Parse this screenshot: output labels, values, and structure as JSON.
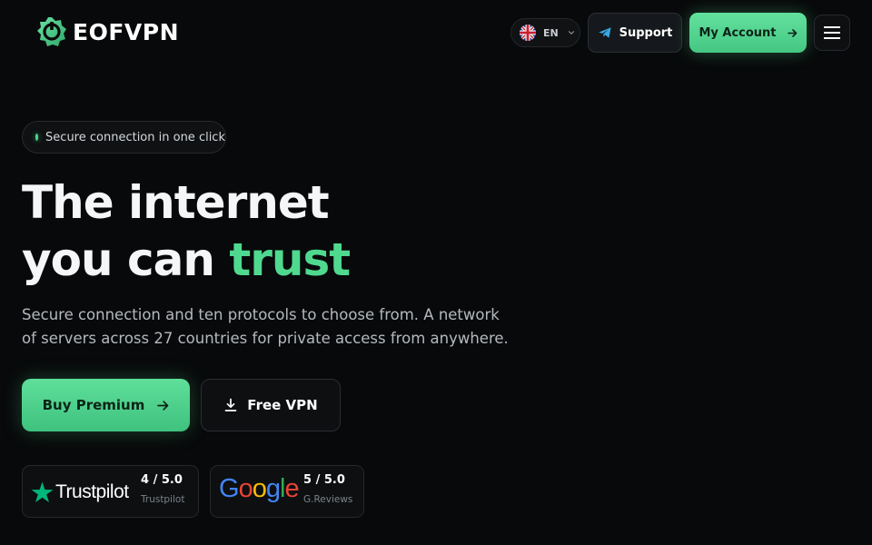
{
  "header": {
    "brand_name": "EOFVPN",
    "language": {
      "code": "EN",
      "flag_icon": "uk-flag-icon"
    },
    "support_label": "Support",
    "account_label": "My Account",
    "menu_icon": "hamburger-menu-icon"
  },
  "hero": {
    "badge_text": "Secure connection in one click",
    "title_line1": "The internet",
    "title_line2_plain": "you can ",
    "title_line2_accent": "trust",
    "description": "Secure connection and ten protocols to choose from. A network of servers across 27 countries for private access from anywhere.",
    "buy_label": "Buy Premium",
    "free_label": "Free VPN"
  },
  "reviews": [
    {
      "brand": "Trustpilot",
      "score": "4 / 5.0",
      "source": "Trustpilot"
    },
    {
      "brand": "Google",
      "score": "5 / 5.0",
      "source": "G.Reviews"
    }
  ],
  "colors": {
    "background": "#08090a",
    "accent": "#4fd98f",
    "accent_button": "#55d690",
    "text_primary": "#f4f6f7",
    "text_muted": "#b4b9be"
  }
}
